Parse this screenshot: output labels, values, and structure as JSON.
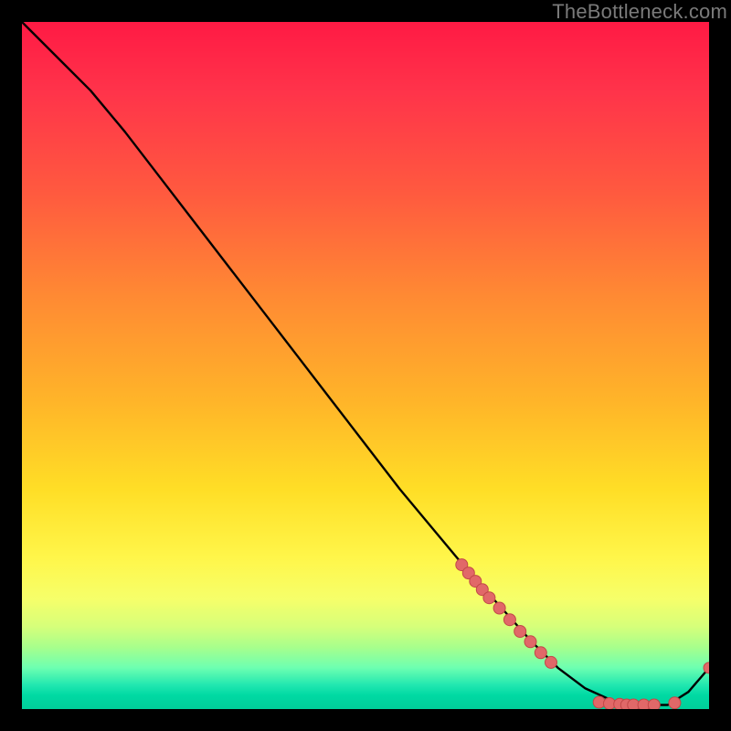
{
  "watermark": "TheBottleneck.com",
  "colors": {
    "line": "#000000",
    "marker_fill": "#e16868",
    "marker_stroke": "#c24848",
    "background": "#000000"
  },
  "chart_data": {
    "type": "line",
    "title": "",
    "xlabel": "",
    "ylabel": "",
    "xlim": [
      0,
      100
    ],
    "ylim": [
      0,
      100
    ],
    "grid": false,
    "legend": false,
    "series": [
      {
        "name": "bottleneck-curve",
        "x": [
          0,
          3,
          6,
          10,
          15,
          20,
          25,
          30,
          35,
          40,
          45,
          50,
          55,
          60,
          65,
          70,
          74,
          78,
          82,
          86,
          90,
          94,
          97,
          100
        ],
        "y": [
          100,
          97,
          94,
          90,
          84,
          77.5,
          71,
          64.5,
          58,
          51.5,
          45,
          38.5,
          32,
          26,
          20,
          14.5,
          10,
          6,
          3,
          1.2,
          0.6,
          0.6,
          2.5,
          6
        ]
      }
    ],
    "markers": [
      {
        "name": "cluster-upper",
        "points": [
          {
            "x": 64,
            "y": 21
          },
          {
            "x": 65,
            "y": 19.8
          },
          {
            "x": 66,
            "y": 18.6
          },
          {
            "x": 67,
            "y": 17.4
          },
          {
            "x": 68,
            "y": 16.2
          },
          {
            "x": 69.5,
            "y": 14.7
          },
          {
            "x": 71,
            "y": 13
          },
          {
            "x": 72.5,
            "y": 11.3
          },
          {
            "x": 74,
            "y": 9.8
          },
          {
            "x": 75.5,
            "y": 8.2
          },
          {
            "x": 77,
            "y": 6.8
          }
        ]
      },
      {
        "name": "cluster-lower",
        "points": [
          {
            "x": 84,
            "y": 1.0
          },
          {
            "x": 85.5,
            "y": 0.8
          },
          {
            "x": 87,
            "y": 0.7
          },
          {
            "x": 88,
            "y": 0.6
          },
          {
            "x": 89,
            "y": 0.6
          },
          {
            "x": 90.5,
            "y": 0.6
          },
          {
            "x": 92,
            "y": 0.6
          },
          {
            "x": 95,
            "y": 0.9
          }
        ]
      },
      {
        "name": "end-point",
        "points": [
          {
            "x": 100,
            "y": 6
          }
        ]
      }
    ]
  }
}
